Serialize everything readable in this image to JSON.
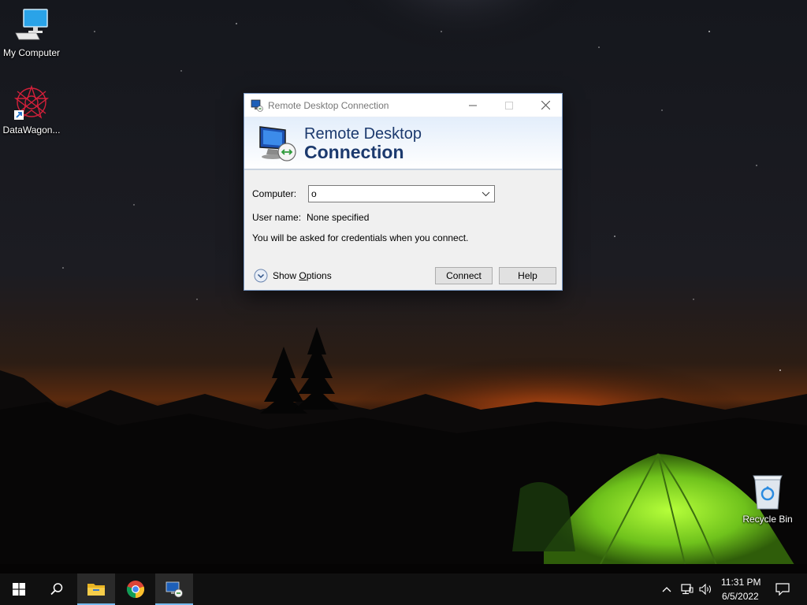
{
  "desktop": {
    "icons": [
      {
        "label": "My Computer"
      },
      {
        "label": "DataWagon..."
      },
      {
        "label": "Recycle Bin"
      }
    ]
  },
  "rdp": {
    "window_title": "Remote Desktop Connection",
    "banner_line1": "Remote Desktop",
    "banner_line2": "Connection",
    "computer_label": "Computer:",
    "computer_value": "o",
    "username_label": "User name:",
    "username_value": "None specified",
    "note": "You will be asked for credentials when you connect.",
    "show_options_prefix": "Show ",
    "show_options_accel": "O",
    "show_options_suffix": "ptions",
    "connect_label": "Connect",
    "help_label": "Help"
  },
  "taskbar": {
    "icons": [
      "windows-start-icon",
      "search-icon",
      "file-explorer-icon",
      "chrome-icon",
      "remote-desktop-icon"
    ],
    "time": "11:31 PM",
    "date": "6/5/2022",
    "tray_icons": [
      "chevron-up-icon",
      "network-icon",
      "volume-icon",
      "notification-icon"
    ]
  },
  "colors": {
    "accent": "#76b9ed",
    "banner_text": "#1c3a6e",
    "tent_green": "#7ed321",
    "horizon_glow": "#e8651a"
  }
}
